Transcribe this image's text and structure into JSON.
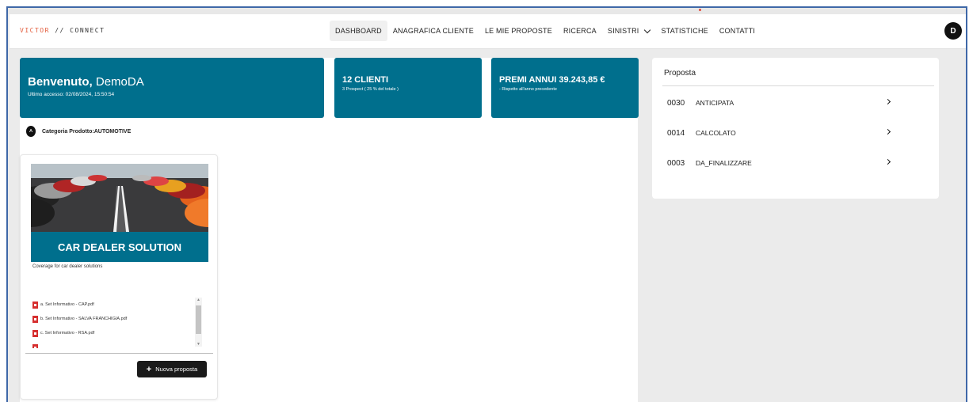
{
  "app": {
    "logo_prefix": "VICTOR",
    "logo_suffix": "// CONNECT",
    "avatar_initial": "D",
    "accent_color": "#e35d3d",
    "brand_color": "#006f8d"
  },
  "nav": {
    "items": [
      {
        "label": "DASHBOARD",
        "active": true
      },
      {
        "label": "ANAGRAFICA CLIENTE"
      },
      {
        "label": "LE MIE PROPOSTE"
      },
      {
        "label": "RICERCA"
      },
      {
        "label": "SINISTRI"
      },
      {
        "label": "STATISTICHE"
      },
      {
        "label": "CONTATTI"
      }
    ]
  },
  "welcome": {
    "greeting": "Benvenuto,",
    "user": "DemoDA",
    "last_access": "Ultimo accesso: 02/08/2024, 15:50:54"
  },
  "stats": {
    "clients_title": "12 CLIENTI",
    "clients_sub": "3 Prospect ( 25 % del totale )",
    "premi_title": "PREMI ANNUI 39.243,85 €",
    "premi_sub": "- Rispetto all'anno precedente"
  },
  "category": {
    "label": "Categoria Prodotto:AUTOMOTIVE",
    "icon": "chevron-up-circle-icon"
  },
  "product": {
    "banner": "CAR DEALER SOLUTION",
    "description": "Coverage for car dealer solutions",
    "docs": [
      "a. Set Informativo - CAP.pdf",
      "b. Set Informativo - SALVA FRANCHIGIA.pdf",
      "c. Set Informativo - RSA.pdf"
    ],
    "new_button": "Nuova proposta"
  },
  "proposals": {
    "title": "Proposta",
    "items": [
      {
        "num": "0030",
        "status": "ANTICIPATA"
      },
      {
        "num": "0014",
        "status": "CALCOLATO"
      },
      {
        "num": "0003",
        "status": "DA_FINALIZZARE"
      }
    ]
  }
}
